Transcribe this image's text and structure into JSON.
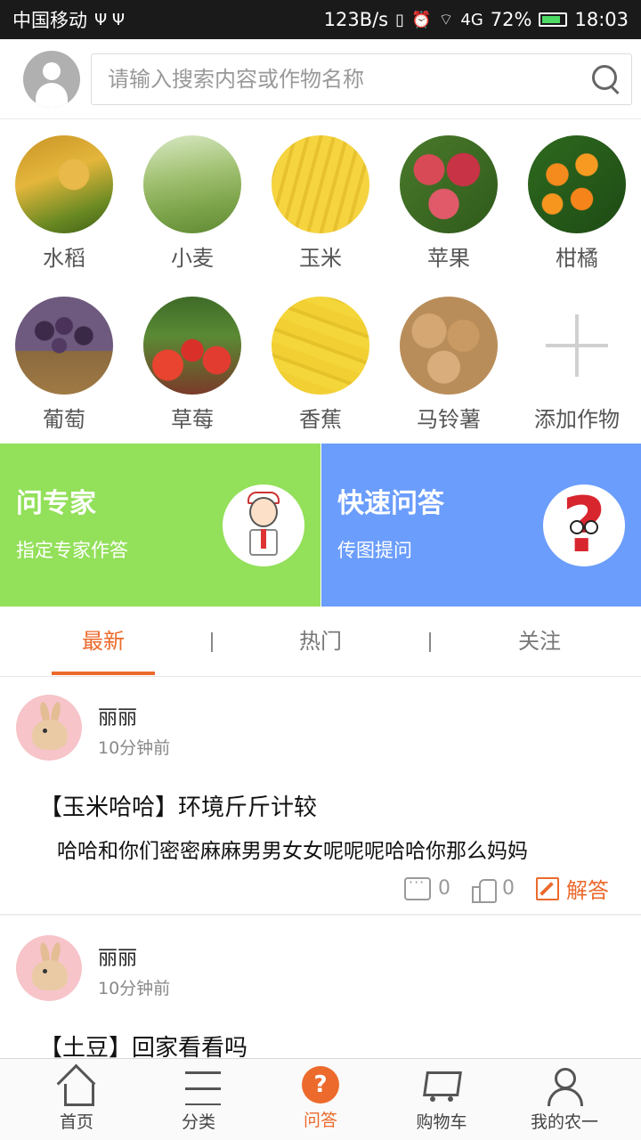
{
  "status_bar": {
    "carrier": "中国移动",
    "net_speed": "123B/s",
    "signal": "4G",
    "battery": "72%",
    "time": "18:03"
  },
  "header": {
    "search_placeholder": "请输入搜索内容或作物名称"
  },
  "crops": [
    {
      "label": "水稻",
      "icon": "rice-image"
    },
    {
      "label": "小麦",
      "icon": "wheat-image"
    },
    {
      "label": "玉米",
      "icon": "corn-image"
    },
    {
      "label": "苹果",
      "icon": "apple-image"
    },
    {
      "label": "柑橘",
      "icon": "citrus-image"
    },
    {
      "label": "葡萄",
      "icon": "grape-image"
    },
    {
      "label": "草莓",
      "icon": "strawberry-image"
    },
    {
      "label": "香蕉",
      "icon": "banana-image"
    },
    {
      "label": "马铃薯",
      "icon": "potato-image"
    },
    {
      "label": "添加作物",
      "icon": "plus-icon"
    }
  ],
  "banners": {
    "expert": {
      "title": "问专家",
      "subtitle": "指定专家作答",
      "color": "#93e05a"
    },
    "quick": {
      "title": "快速问答",
      "subtitle": "传图提问",
      "color": "#6b9dfc"
    }
  },
  "tabs": [
    {
      "label": "最新",
      "active": true
    },
    {
      "label": "热门",
      "active": false
    },
    {
      "label": "关注",
      "active": false
    }
  ],
  "tab_separator": "|",
  "posts": [
    {
      "user": "丽丽",
      "time": "10分钟前",
      "title": "【玉米哈哈】环境斤斤计较",
      "body": "哈哈和你们密密麻麻男男女女呢呢呢哈哈你那么妈妈",
      "comments": "0",
      "likes": "0",
      "answer_label": "解答"
    },
    {
      "user": "丽丽",
      "time": "10分钟前",
      "title": "【土豆】回家看看吗"
    }
  ],
  "bottom_nav": [
    {
      "label": "首页",
      "icon": "home-icon",
      "active": false
    },
    {
      "label": "分类",
      "icon": "list-icon",
      "active": false
    },
    {
      "label": "问答",
      "icon": "question-icon",
      "active": true
    },
    {
      "label": "购物车",
      "icon": "cart-icon",
      "active": false
    },
    {
      "label": "我的农一",
      "icon": "profile-icon",
      "active": false
    }
  ],
  "colors": {
    "accent": "#ec6a2c",
    "status_bar": "#1a1a1a"
  }
}
